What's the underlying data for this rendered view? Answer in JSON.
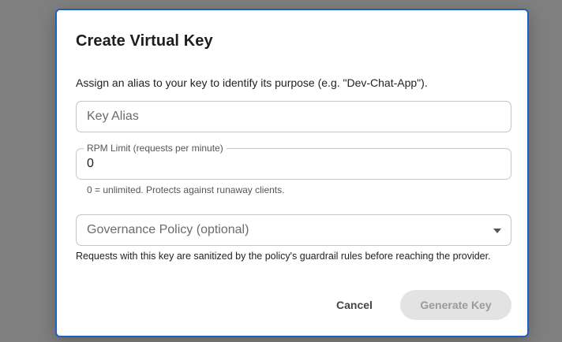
{
  "dialog": {
    "title": "Create Virtual Key",
    "description": "Assign an alias to your key to identify its purpose (e.g. \"Dev-Chat-App\").",
    "alias_placeholder": "Key Alias",
    "rpm_label": "RPM Limit (requests per minute)",
    "rpm_value": "0",
    "rpm_helper": "0 = unlimited. Protects against runaway clients.",
    "policy_placeholder": "Governance Policy (optional)",
    "policy_helper": "Requests with this key are sanitized by the policy's guardrail rules before reaching the provider.",
    "cancel_label": "Cancel",
    "generate_label": "Generate Key"
  },
  "colors": {
    "overlay": "#808080",
    "dialog_border": "#1f5fbf",
    "generate_disabled_bg": "#e3e3e3",
    "generate_disabled_text": "#9a9a9a"
  },
  "icons": {
    "policy_dropdown": "chevron-down-icon"
  }
}
